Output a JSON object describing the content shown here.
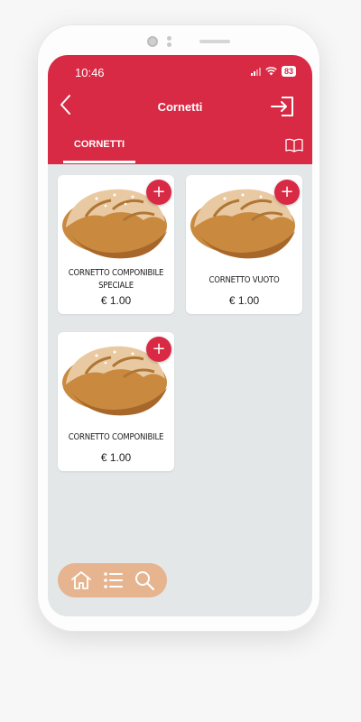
{
  "status": {
    "time": "10:46",
    "battery": "83"
  },
  "header": {
    "title": "Cornetti"
  },
  "tabs": [
    {
      "label": "CORNETTI"
    }
  ],
  "products": [
    {
      "name": "CORNETTO COMPONIBILE SPECIALE",
      "price": "€ 1.00"
    },
    {
      "name": "CORNETTO VUOTO",
      "price": "€ 1.00"
    },
    {
      "name": "CORNETTO COMPONIBILE",
      "price": "€ 1.00"
    }
  ],
  "add_symbol": "+",
  "colors": {
    "accent": "#d82a44",
    "background": "#e3e7e8",
    "nav": "#e6b48f"
  },
  "icons": [
    "back-icon",
    "login-icon",
    "book-icon",
    "plus-icon",
    "home-icon",
    "list-icon",
    "search-icon",
    "croissant-image"
  ]
}
